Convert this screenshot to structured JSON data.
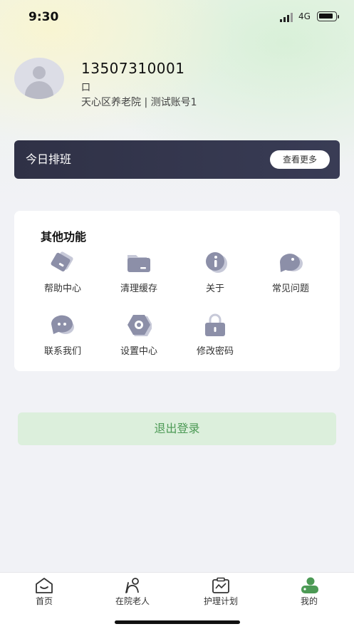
{
  "status_bar": {
    "time": "9:30",
    "network": "4G"
  },
  "profile": {
    "phone": "13507310001",
    "glyph": "口",
    "org": "天心区养老院 | 测试账号1"
  },
  "schedule": {
    "title": "今日排班",
    "more_label": "查看更多"
  },
  "functions": {
    "title": "其他功能",
    "items": [
      {
        "label": "帮助中心",
        "icon": "help-card-icon"
      },
      {
        "label": "清理缓存",
        "icon": "folder-icon"
      },
      {
        "label": "关于",
        "icon": "info-icon"
      },
      {
        "label": "常见问题",
        "icon": "chat-bubble-icon"
      },
      {
        "label": "联系我们",
        "icon": "message-icon"
      },
      {
        "label": "设置中心",
        "icon": "settings-icon"
      },
      {
        "label": "修改密码",
        "icon": "lock-icon"
      }
    ]
  },
  "logout_label": "退出登录",
  "tabbar": {
    "tabs": [
      {
        "label": "首页",
        "icon": "home-icon"
      },
      {
        "label": "在院老人",
        "icon": "elder-icon"
      },
      {
        "label": "护理计划",
        "icon": "care-plan-icon"
      },
      {
        "label": "我的",
        "icon": "profile-icon"
      }
    ],
    "active_index": 3
  },
  "colors": {
    "accent_green": "#4c9a55",
    "schedule_bg": "#2f3146",
    "icon_gray": "#8c8fa8"
  }
}
